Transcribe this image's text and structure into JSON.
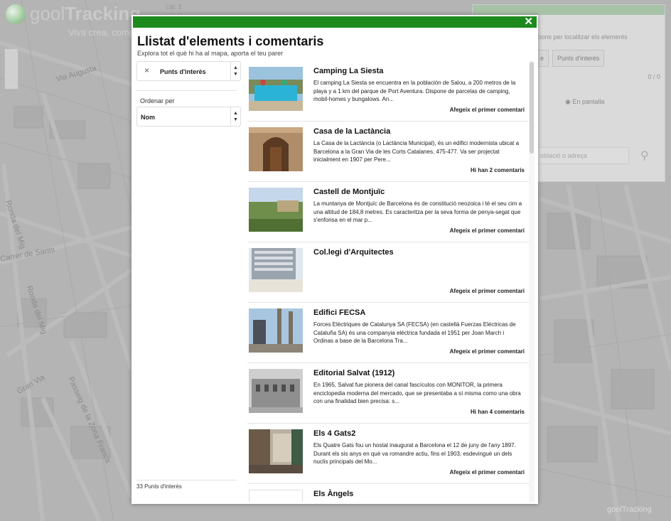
{
  "app": {
    "logo_light": "gool",
    "logo_bold": "Tracking",
    "tagline": "Viva crea, comp",
    "lang": "cat",
    "footer_logo": "goolTracking"
  },
  "map_labels": [
    "Via Augusta",
    "Carrer de Sants",
    "Ronda del Mig",
    "Ronda del Mig",
    "Gran Via",
    "Passeig de la Zona Franca"
  ],
  "right_panel": {
    "hint": "cions per localitzar els elements",
    "tab1": "e",
    "tab2": "Punts d'interès",
    "counter": "0 / 0",
    "radio_label": "En pantalla",
    "search_placeholder": "oblació o adreça"
  },
  "modal": {
    "close": "✕",
    "title": "Llistat d'elements i comentaris",
    "subtitle": "Explora tot el què hi ha al mapa, aporta el teu parer",
    "filter_value": "Punts d'interès",
    "filter_clear": "×",
    "order_label": "Ordenar per",
    "order_value": "Nom",
    "count_label": "33 Punts d'interès"
  },
  "items": [
    {
      "title": "Camping La Siesta",
      "description": "El camping La Siesta se encuentra en la población de Salou, a 200 metros de la playa y a 1 km del parque de Port Aventura. Dispone de parcelas de camping, mobil-homes y bungalows. An...",
      "link": "Afegeix el primer comentari",
      "thumb": "pool"
    },
    {
      "title": "Casa de la Lactància",
      "description": "La Casa de la Lactància (o Lactància Municipal), és un edifici modernista ubicat a Barcelona a la Gran Via de les Corts Catalanes, 475-477. Va ser projectat inicialment en 1907 per Pere...",
      "link": "Hi han 2 comentaris",
      "thumb": "door"
    },
    {
      "title": "Castell de Montjuïc",
      "description": "La muntanya de Montjuïc de Barcelona és de constitució neozoica i té el seu cim a una altitud de 184,8 metres. Es caracteritza per la seva forma de penya-segat que s'enfonsa en el mar p...",
      "link": "Afegeix el primer comentari",
      "thumb": "castle"
    },
    {
      "title": "Col.legi d'Arquitectes",
      "description": "",
      "link": "Afegeix el primer comentari",
      "thumb": "building"
    },
    {
      "title": "Edifici FECSA",
      "description": "Forces Elèctriques de Catalunya SA (FECSA) (en castellà Fuerzas Eléctricas de Cataluña SA) és una companyia elèctrica fundada el 1951 per Joan March i Ordinas a base de la Barcelona Tra...",
      "link": "Afegeix el primer comentari",
      "thumb": "tower"
    },
    {
      "title": "Editorial Salvat (1912)",
      "description": "En 1965, Salvat fue pionera del canal fascículos con MONITOR, la primera enciclopedia moderna del mercado, que se presentaba a sí misma como una obra con una finalidad bien precisa: s...",
      "link": "Hi han 4 comentaris",
      "thumb": "facade"
    },
    {
      "title": "Els 4 Gats2",
      "description": "Els Quatre Gats fou un hostal inaugurat a Barcelona el 12 de juny de l'any 1897. Durant els sis anys en què va romandre actiu, fins el 1903, esdevingué un dels nuclis principals del Mo...",
      "link": "Afegeix el primer comentari",
      "thumb": "street"
    },
    {
      "title": "Els Àngels",
      "description": "",
      "link": "",
      "thumb": "blank"
    }
  ]
}
